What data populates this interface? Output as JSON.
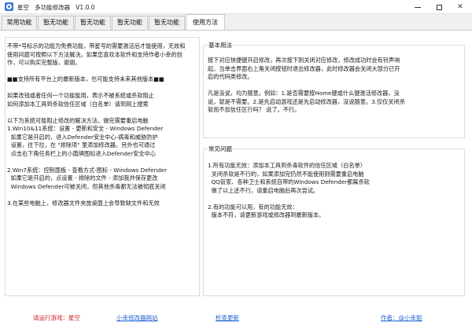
{
  "window": {
    "title": "星空   多功能修改器   V1.0.0",
    "icon": "star-app-icon",
    "controls": [
      "minimize-icon",
      "maximize-icon",
      "close-icon"
    ]
  },
  "tabs": [
    {
      "label": "常用功能",
      "active": false
    },
    {
      "label": "暂无功能",
      "active": false
    },
    {
      "label": "暂无功能",
      "active": false
    },
    {
      "label": "暂无功能",
      "active": false
    },
    {
      "label": "暂无功能",
      "active": false
    },
    {
      "label": "使用方法",
      "active": true
    }
  ],
  "left_text": {
    "lines": [
      "不带*号标示的功能为免费功能，带星号的需要激活后才能使用，无效和",
      "使用问题可按照以下方法解决。如果您喜欢本软件和支持作者小幸的创",
      "作，可以购买完整版，谢谢。",
      "",
      "■■支持所有平台上的最新版本，也可能支持未来其他版本■■",
      "",
      "如果改钱或者任何一个功能能用，表示不被系统或杀软阻止",
      "如何添加本工具到杀软信任区域（白名单）请到网上搜索",
      "",
      "以下为系统可能阻止修改的解决方法，做完需要重启电脑",
      "1.Win10&11系统：设置 - 更新和安全 - Windows Defender",
      "  如果它是开启的，进入Defender安全中心-病毒和威胁防护",
      "  设置，往下拉，在 \"排除项\" 里添加修改器。另外也可通过",
      "  点击右下角任务栏上的小盾牌图标进入Defender安全中心",
      "",
      "2.Win7系统：控制面板 - 查看方式-图标 - Windows Defender",
      "  如果它是开启的，点设置 - 排除的文件 - 添加我并保存更改",
      "  Windows Defender可被关闭，但其他杀毒都无法被彻底关闭",
      "",
      "3.在某些电脑上，修改器文件夹放桌面上会导致缺文件和无效"
    ]
  },
  "basic_usage": {
    "title": "基本用法",
    "lines": [
      "按下对应快捷键开启修改，再次按下则关闭对应修改，修改成功时会有铃声响",
      "起。当单击界面右上角关闭按钮时退出修改器，此时修改器会关闭大部分已开",
      "启的代码类修改。",
      "",
      "凡是没说，均为随意。例如：1.是否需要按Home键或什么键激活修改器，没",
      "说，就是不需要。2.是先启动游戏还是先启动修改器，没说随意。3.仅仅关闭杀",
      "软而不加信任区行吗？ 说了，不行。"
    ]
  },
  "faq": {
    "title": "常见问题",
    "lines": [
      "1.所有功能无效：添加本工具到杀毒软件的信任区域（白名单）",
      "  关闭杀软是不行的，如果添加完仍然不能使用则需要重启电脑",
      "  QQ管家、各种卫士和系统自带的Windows Defender都属杀软",
      "  做了以上还不行，请重启电脑后再次尝试。",
      "",
      "2.有的功能可以用，有的功能无效：",
      "  版本不符，请更新游戏或修改器到最新版本。"
    ]
  },
  "footer": {
    "game": "请运行游戏：星空",
    "site": "小幸修改器网站",
    "update": "检查更新",
    "author": "作者：@小幸姐"
  },
  "colors": {
    "accent_link": "#1a5fd1",
    "warning_red": "#d02020"
  }
}
